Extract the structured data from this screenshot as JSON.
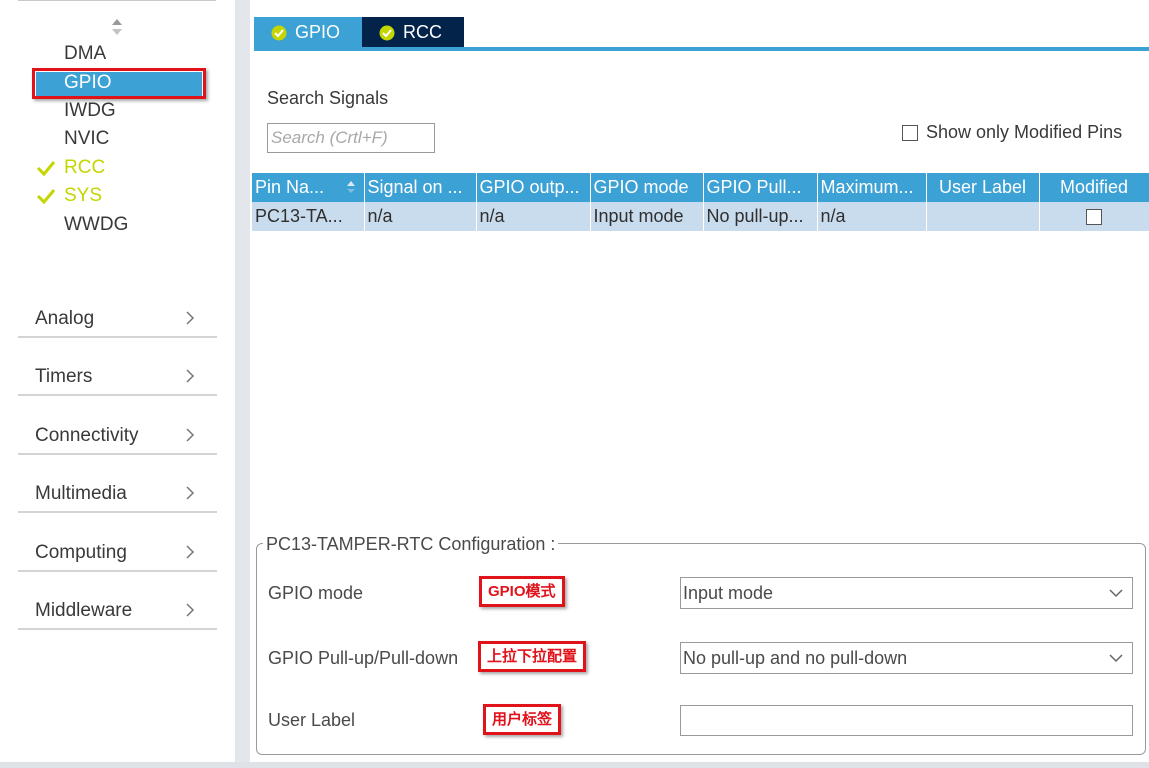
{
  "sidebar": {
    "system_items": [
      {
        "label": "DMA",
        "enabled": false
      },
      {
        "label": "GPIO",
        "enabled": false,
        "selected": true
      },
      {
        "label": "IWDG",
        "enabled": false
      },
      {
        "label": "NVIC",
        "enabled": false
      },
      {
        "label": "RCC",
        "enabled": true
      },
      {
        "label": "SYS",
        "enabled": true
      },
      {
        "label": "WWDG",
        "enabled": false
      }
    ],
    "categories": [
      {
        "label": "Analog"
      },
      {
        "label": "Timers"
      },
      {
        "label": "Connectivity"
      },
      {
        "label": "Multimedia"
      },
      {
        "label": "Computing"
      },
      {
        "label": "Middleware"
      }
    ]
  },
  "tabs": [
    {
      "label": "GPIO",
      "active": true
    },
    {
      "label": "RCC",
      "active": false
    }
  ],
  "search": {
    "label": "Search Signals",
    "placeholder": "Search (Crtl+F)",
    "value": ""
  },
  "show_modified": {
    "label": "Show only Modified Pins",
    "checked": false
  },
  "table": {
    "columns": [
      "Pin Na...",
      "Signal on ...",
      "GPIO outp...",
      "GPIO mode",
      "GPIO Pull...",
      "Maximum...",
      "User Label",
      "Modified"
    ],
    "rows": [
      {
        "pin": "PC13-TA...",
        "signal": "n/a",
        "output": "n/a",
        "mode": "Input mode",
        "pull": "No pull-up...",
        "max": "n/a",
        "user_label": "",
        "modified": false
      }
    ]
  },
  "config": {
    "title": "PC13-TAMPER-RTC Configuration :",
    "gpio_mode": {
      "label": "GPIO mode",
      "value": "Input mode",
      "annotation": "GPIO模式"
    },
    "gpio_pull": {
      "label": "GPIO Pull-up/Pull-down",
      "value": "No pull-up and no pull-down",
      "annotation": "上拉下拉配置"
    },
    "user_label": {
      "label": "User Label",
      "value": "",
      "annotation": "用户标签"
    }
  },
  "colors": {
    "accent": "#3ca1d5",
    "tab_dark": "#03234b",
    "enabled_green": "#c4d600",
    "annotation_red": "#e0121a",
    "row_selected": "#c9dced"
  },
  "icons": {
    "tab_status": "check-circle-icon",
    "enabled": "check-icon",
    "category": "chevron-right-icon",
    "scroll": "scroll-up-down-icon",
    "sort": "sort-ascending-icon",
    "dropdown": "chevron-down-icon"
  }
}
